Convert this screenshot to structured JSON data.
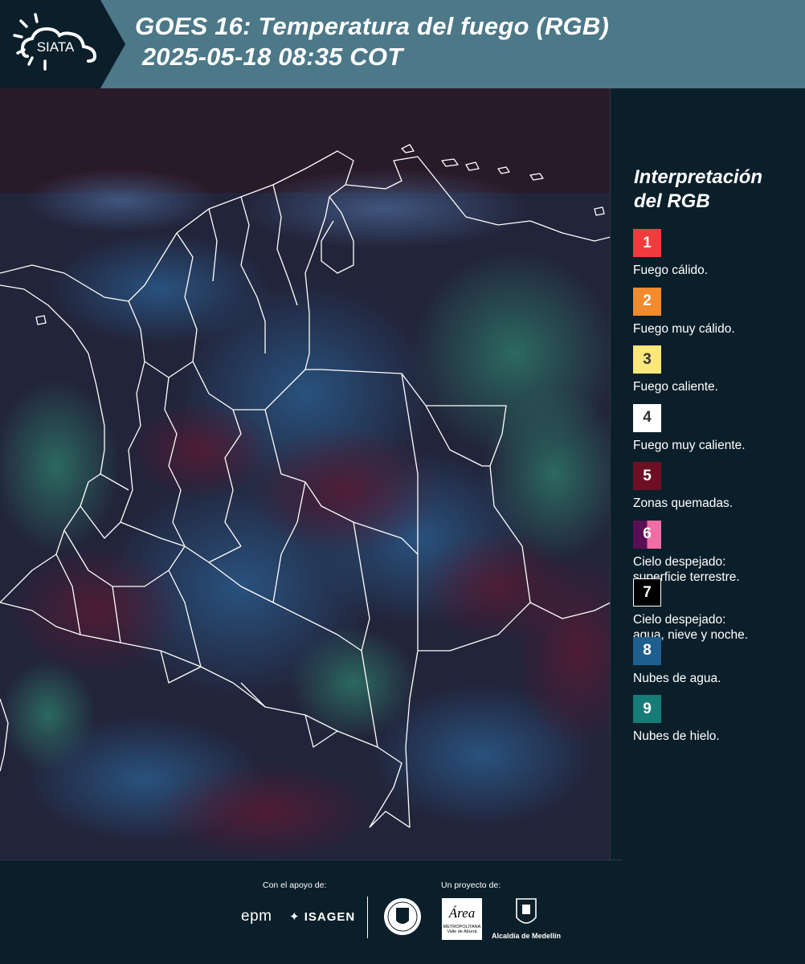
{
  "header": {
    "logo_text": "SIATA",
    "title_line1": "GOES 16: Temperatura del fuego (RGB)",
    "title_line2": " 2025-05-18 08:35 COT"
  },
  "legend": {
    "title_line1": "Interpretación",
    "title_line2": "del RGB",
    "items": [
      {
        "num": "1",
        "label": "Fuego cálido.",
        "color": "#f03c3c",
        "text_color": "#ffffff"
      },
      {
        "num": "2",
        "label": "Fuego muy cálido.",
        "color": "#f28a2e",
        "text_color": "#ffffff"
      },
      {
        "num": "3",
        "label": "Fuego caliente.",
        "color": "#fbe77a",
        "text_color": "#333333"
      },
      {
        "num": "4",
        "label": "Fuego muy caliente.",
        "color": "#ffffff",
        "text_color": "#333333"
      },
      {
        "num": "5",
        "label": "Zonas quemadas.",
        "color": "#6e1024",
        "text_color": "#ffffff"
      },
      {
        "num": "6",
        "label": "Cielo despejado:",
        "label2": "superficie terrestre.",
        "color": "#5a0f55",
        "color2": "#f06ea6",
        "text_color": "#ffffff"
      },
      {
        "num": "7",
        "label": "Cielo despejado:",
        "label2": "agua, nieve y noche.",
        "color": "#000000",
        "text_color": "#ffffff",
        "border": "#ffffff"
      },
      {
        "num": "8",
        "label": "Nubes de agua.",
        "color": "#1f5f8f",
        "text_color": "#ffffff"
      },
      {
        "num": "9",
        "label": "Nubes de hielo.",
        "color": "#177b78",
        "text_color": "#ffffff"
      }
    ]
  },
  "footer": {
    "support_label": "Con el apoyo de:",
    "project_label": "Un proyecto de:",
    "epm": "epm",
    "isagen": "ISAGEN",
    "area_name": "Área",
    "area_line1": "METROPOLITANA",
    "area_line2": "Valle de Aburrá",
    "medellin": "Alcaldía de Medellín"
  },
  "map": {
    "background": "#1e2a3e",
    "boundary_color": "#ffffff"
  }
}
